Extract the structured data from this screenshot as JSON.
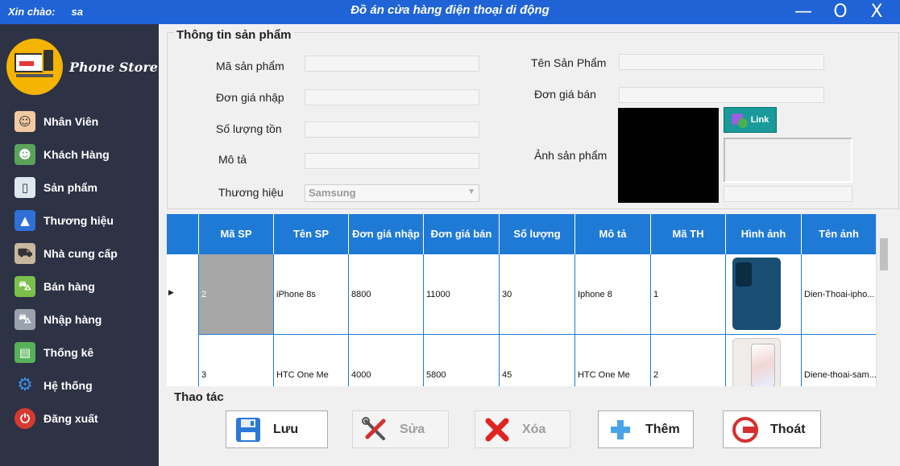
{
  "window": {
    "greeting": "Xin chào:",
    "user": "sa",
    "title": "Đồ án cửa hàng điện thoại di động",
    "min": "—",
    "max": "O",
    "close": "X"
  },
  "logo": {
    "text": "Phone Store"
  },
  "nav": [
    {
      "label": "Nhân Viên",
      "icon": "staff-icon"
    },
    {
      "label": "Khách Hàng",
      "icon": "customers-icon"
    },
    {
      "label": "Sản phẩm",
      "icon": "phone-icon"
    },
    {
      "label": "Thương hiệu",
      "icon": "folder-icon"
    },
    {
      "label": "Nhà cung cấp",
      "icon": "truck-icon"
    },
    {
      "label": "Bán hàng",
      "icon": "cart-icon"
    },
    {
      "label": "Nhập hàng",
      "icon": "cart-icon"
    },
    {
      "label": "Thống kê",
      "icon": "report-icon"
    },
    {
      "label": "Hệ thống",
      "icon": "gear-icon"
    },
    {
      "label": "Đăng xuất",
      "icon": "power-icon"
    }
  ],
  "form": {
    "group_title": "Thông tin sản phẩm",
    "ma_sp": "Mã sản phẩm",
    "don_gia_nhap": "Đơn giá nhập",
    "so_luong_ton": "Số lượng tồn",
    "mo_ta": "Mô tả",
    "thuong_hieu": "Thương hiệu",
    "thuong_hieu_value": "Samsung",
    "ten_sp": "Tên Sản Phẩm",
    "don_gia_ban": "Đơn giá bán",
    "anh_sp": "Ảnh sản phẩm",
    "link_label": "Link"
  },
  "grid": {
    "columns": [
      "Mã SP",
      "Tên SP",
      "Đơn giá nhập",
      "Đơn giá bán",
      "Số lượng",
      "Mô tả",
      "Mã TH",
      "Hình ảnh",
      "Tên ảnh"
    ],
    "rows": [
      {
        "ma": "2",
        "ten": "iPhone 8s",
        "nhap": "8800",
        "ban": "11000",
        "sl": "30",
        "mota": "Iphone 8",
        "math": "1",
        "tenanh": "Dien-Thoai-ipho..."
      },
      {
        "ma": "3",
        "ten": "HTC One Me",
        "nhap": "4000",
        "ban": "5800",
        "sl": "45",
        "mota": "HTC One Me",
        "math": "2",
        "tenanh": "Diene-thoai-sam..."
      }
    ]
  },
  "actions": {
    "title": "Thao tác",
    "save": "Lưu",
    "edit": "Sửa",
    "delete": "Xóa",
    "add": "Thêm",
    "exit": "Thoát"
  },
  "colors": {
    "titlebar": "#1f63d6",
    "sidebar": "#2e3245",
    "grid_header": "#1f7ad6"
  }
}
